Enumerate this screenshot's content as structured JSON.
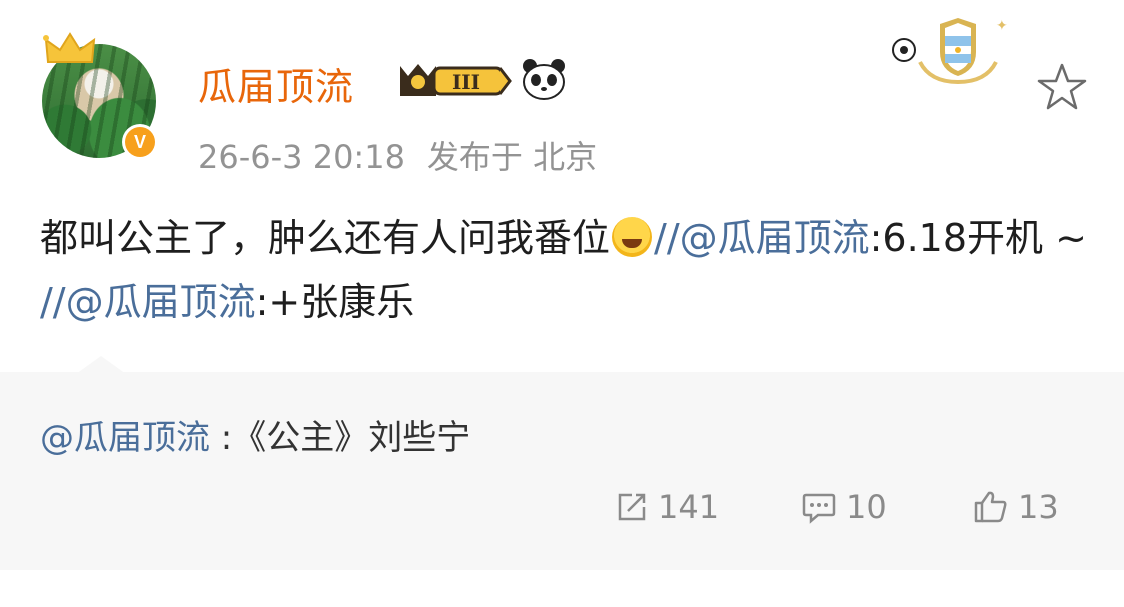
{
  "post": {
    "username": "瓜届顶流",
    "level_badge": "III",
    "time": "26-6-3 20:18",
    "location": "发布于 北京",
    "text_part1": "都叫公主了，肿么还有人问我番位",
    "mention1": "//@瓜届顶流",
    "mention1_colon": "",
    "text_part2": ":6.18开机 ~ ",
    "mention2": "//@瓜届顶流",
    "text_part3": ":+张康乐"
  },
  "repost": {
    "mention": "@瓜届顶流",
    "text": " :《公主》刘些宁"
  },
  "actions": {
    "share_count": "141",
    "comment_count": "10",
    "like_count": "13"
  },
  "colors": {
    "name": "#e8660a",
    "link": "#4a6e9a",
    "meta": "#939393",
    "repost_bg": "#f7f7f7"
  }
}
